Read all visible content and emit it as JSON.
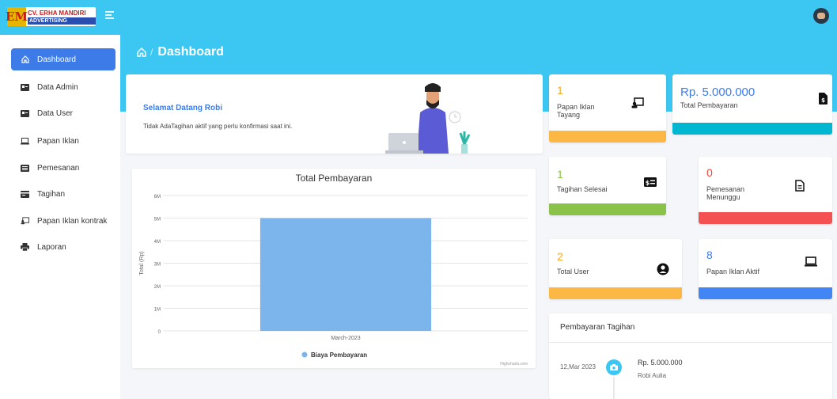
{
  "brand": {
    "mark": "EM",
    "name": "CV. ERHA MANDIRI",
    "tagline": "ADVERTISING"
  },
  "header": {
    "page_title": "Dashboard"
  },
  "sidebar": {
    "items": [
      {
        "label": "Dashboard",
        "icon": "home-icon"
      },
      {
        "label": "Data Admin",
        "icon": "id-card-icon"
      },
      {
        "label": "Data User",
        "icon": "id-card-icon"
      },
      {
        "label": "Papan Iklan",
        "icon": "laptop-icon"
      },
      {
        "label": "Pemesanan",
        "icon": "list-icon"
      },
      {
        "label": "Tagihan",
        "icon": "card-icon"
      },
      {
        "label": "Papan Iklan kontrak",
        "icon": "board-icon"
      },
      {
        "label": "Laporan",
        "icon": "print-icon"
      }
    ]
  },
  "welcome": {
    "greeting": "Selamat Datang Robi",
    "message": "Tidak AdaTagihan aktif yang perlu konfirmasi saat ini."
  },
  "stats": {
    "papan_tayang": {
      "value": "1",
      "label": "Papan Iklan Tayang",
      "color": "#f9a825",
      "bar": "#fbb844"
    },
    "total_pembayaran": {
      "value": "Rp. 5.000.000",
      "label": "Total Pembayaran",
      "color": "#3d7ce8",
      "bar": "#00b7d2"
    },
    "tagihan_selesai": {
      "value": "1",
      "label": "Tagihan Selesai",
      "color": "#8bc34a",
      "bar": "#8bc34a"
    },
    "pemesanan_menunggu": {
      "value": "0",
      "label": "Pemesanan Menunggu",
      "color": "#f44336",
      "bar": "#f45252"
    },
    "total_user": {
      "value": "2",
      "label": "Total User",
      "color": "#f9a825",
      "bar": "#fbb844"
    },
    "papan_aktif": {
      "value": "8",
      "label": "Papan Iklan Aktif",
      "color": "#3d7ce8",
      "bar": "#4285f4"
    }
  },
  "payments": {
    "title": "Pembayaran Tagihan",
    "items": [
      {
        "date": "12,Mar 2023",
        "amount": "Rp. 5.000.000",
        "name": "Robi Aulia"
      }
    ]
  },
  "chart_data": {
    "type": "bar",
    "title": "Total Pembayaran",
    "ylabel": "Total (Rp)",
    "categories": [
      "March-2023"
    ],
    "series": [
      {
        "name": "Biaya Pembayaran",
        "values": [
          5000000
        ],
        "color": "#7cb5ec"
      }
    ],
    "ylim": [
      0,
      6000000
    ],
    "yticks": [
      "0",
      "1M",
      "2M",
      "3M",
      "4M",
      "5M",
      "6M"
    ],
    "credit": "Highcharts.com",
    "legend": "bottom"
  }
}
